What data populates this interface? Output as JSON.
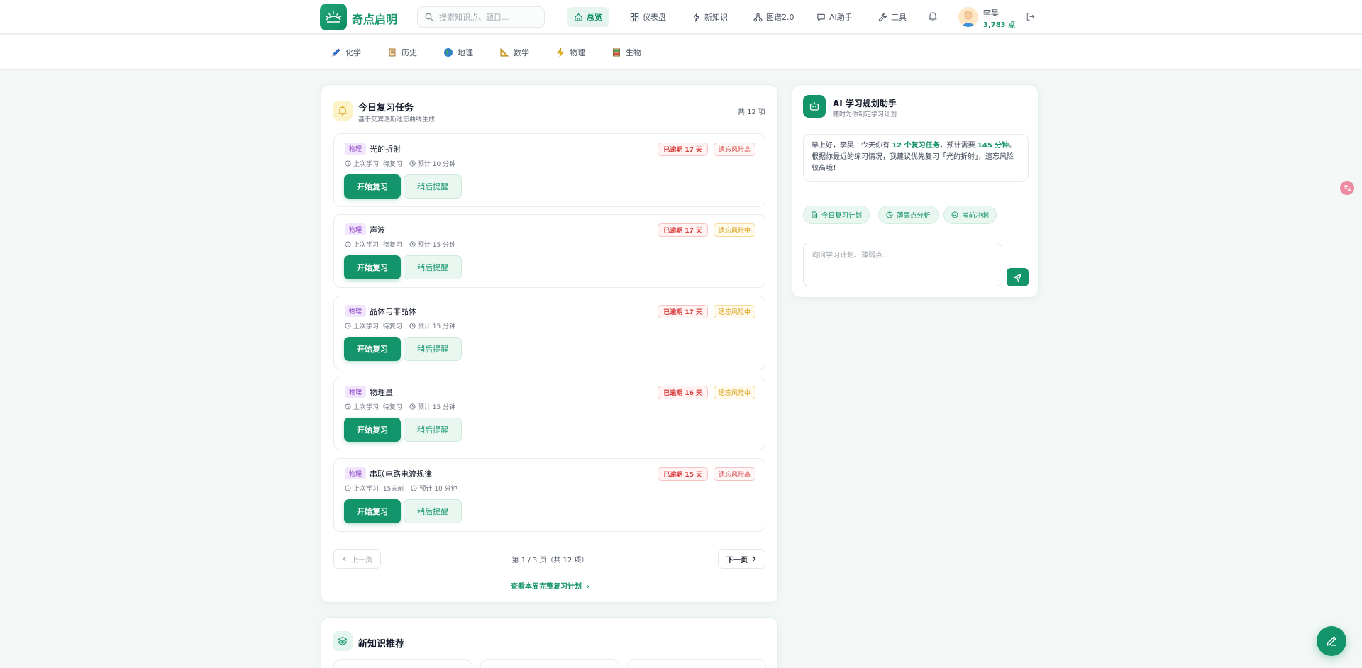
{
  "app": {
    "name": "奇点启明"
  },
  "search": {
    "placeholder": "搜索知识点、题目..."
  },
  "nav": [
    {
      "label": "总览",
      "icon": "home-icon",
      "active": true
    },
    {
      "label": "仪表盘",
      "icon": "dashboard-icon",
      "active": false
    },
    {
      "label": "新知识",
      "icon": "lightning-icon",
      "active": false
    },
    {
      "label": "图谱2.0",
      "icon": "graph-icon",
      "active": false
    },
    {
      "label": "AI助手",
      "icon": "chat-icon",
      "active": false
    },
    {
      "label": "工具",
      "icon": "wrench-icon",
      "active": false
    }
  ],
  "user": {
    "name": "李昊",
    "points": "3,783 点"
  },
  "subjects": [
    {
      "label": "化学",
      "icon": "pencil-icon"
    },
    {
      "label": "历史",
      "icon": "scroll-icon"
    },
    {
      "label": "地理",
      "icon": "globe-icon"
    },
    {
      "label": "数学",
      "icon": "ruler-icon"
    },
    {
      "label": "物理",
      "icon": "lightning-icon"
    },
    {
      "label": "生物",
      "icon": "book-icon"
    }
  ],
  "tasks_card": {
    "title": "今日复习任务",
    "subtitle": "基于艾宾浩斯遗忘曲线生成",
    "count": "共 12 项",
    "items": [
      {
        "subject": "物理",
        "name": "光的折射",
        "last": "上次学习: 待复习",
        "estimate": "预计 10 分钟",
        "overdue": "已逾期 17 天",
        "risk": "遗忘风险高",
        "risk_level": "high",
        "start": "开始复习",
        "later": "稍后提醒"
      },
      {
        "subject": "物理",
        "name": "声波",
        "last": "上次学习: 待复习",
        "estimate": "预计 15 分钟",
        "overdue": "已逾期 17 天",
        "risk": "遗忘风险中",
        "risk_level": "mid",
        "start": "开始复习",
        "later": "稍后提醒"
      },
      {
        "subject": "物理",
        "name": "晶体与非晶体",
        "last": "上次学习: 待复习",
        "estimate": "预计 15 分钟",
        "overdue": "已逾期 17 天",
        "risk": "遗忘风险中",
        "risk_level": "mid",
        "start": "开始复习",
        "later": "稍后提醒"
      },
      {
        "subject": "物理",
        "name": "物理量",
        "last": "上次学习: 待复习",
        "estimate": "预计 15 分钟",
        "overdue": "已逾期 16 天",
        "risk": "遗忘风险中",
        "risk_level": "mid",
        "start": "开始复习",
        "later": "稍后提醒"
      },
      {
        "subject": "物理",
        "name": "串联电路电流规律",
        "last": "上次学习: 15天前",
        "estimate": "预计 10 分钟",
        "overdue": "已逾期 15 天",
        "risk": "遗忘风险高",
        "risk_level": "high",
        "start": "开始复习",
        "later": "稍后提醒"
      }
    ],
    "pager": {
      "prev": "上一页",
      "info": "第 1 / 3 页（共 12 项）",
      "next": "下一页"
    },
    "week_link": "查看本周完整复习计划"
  },
  "new_knowledge": {
    "title": "新知识推荐"
  },
  "ai_card": {
    "title": "AI 学习规划助手",
    "subtitle": "随时为你制定学习计划",
    "message": {
      "p1": "早上好，李昊！今天你有 ",
      "b1": "12 个复习任务",
      "p2": "，预计需要 ",
      "b2": "145 分钟",
      "p3": "。根据你最近的练习情况，我建议优先复习「光的折射」，遗忘风险较高哦！"
    },
    "chips": [
      {
        "label": "今日复习计划",
        "icon": "document-icon"
      },
      {
        "label": "薄弱点分析",
        "icon": "pie-icon"
      },
      {
        "label": "考前冲刺",
        "icon": "check-circle-icon"
      }
    ],
    "input_placeholder": "询问学习计划、薄弱点..."
  },
  "colors": {
    "primary": "#14946a",
    "danger": "#d93636",
    "warning": "#d59a0a",
    "subject_tag": "#8b3fc7"
  }
}
